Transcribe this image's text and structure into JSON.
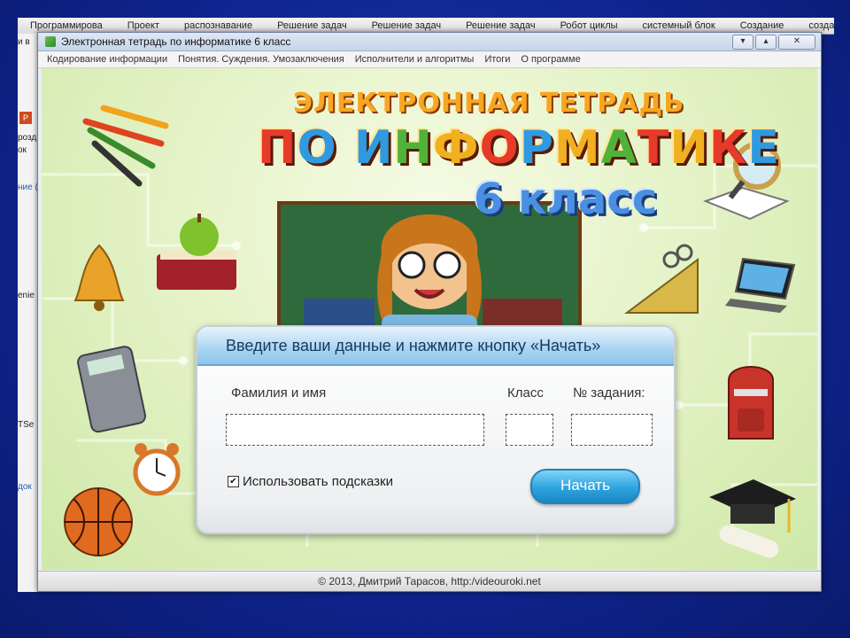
{
  "taskbar": {
    "items": [
      "Программирова",
      "Проект",
      "распознавание",
      "Решение задач",
      "Решение задач",
      "Решение задач",
      "Робот циклы",
      "системный блок",
      "Создание",
      "создан"
    ]
  },
  "bg_window": {
    "fragments": [
      "и в",
      "розд",
      "ок",
      "ние (",
      "enie",
      "TSe",
      "док"
    ]
  },
  "window": {
    "title": "Электронная тетрадь по информатике 6 класс",
    "controls": {
      "minimize": "▾",
      "restore": "▴",
      "close": "✕"
    }
  },
  "menu": {
    "items": [
      "Кодирование информации",
      "Понятия. Суждения. Умозаключения",
      "Исполнители и алгоритмы",
      "Итоги",
      "О программе"
    ]
  },
  "banner": {
    "line1": "ЭЛЕКТРОННАЯ ТЕТРАДЬ",
    "line2_letters": [
      "П",
      "О",
      " ",
      "И",
      "Н",
      "Ф",
      "О",
      "Р",
      "М",
      "А",
      "Т",
      "И",
      "К",
      "Е"
    ],
    "line3": "6 класс"
  },
  "dialog": {
    "header": "Введите ваши данные и нажмите кнопку «Начать»",
    "name_label": "Фамилия и имя",
    "class_label": "Класс",
    "task_label": "№ задания:",
    "name_value": "",
    "class_value": "",
    "task_value": "",
    "hints_label": "Использовать подсказки",
    "hints_checked": "✔",
    "start_label": "Начать"
  },
  "footer": {
    "text": "© 2013, Дмитрий Тарасов, http:/videouroki.net"
  },
  "colors": {
    "desktop": "#1533a0",
    "accent_blue": "#2ea3de",
    "canvas_green": "#e5f3c8"
  }
}
